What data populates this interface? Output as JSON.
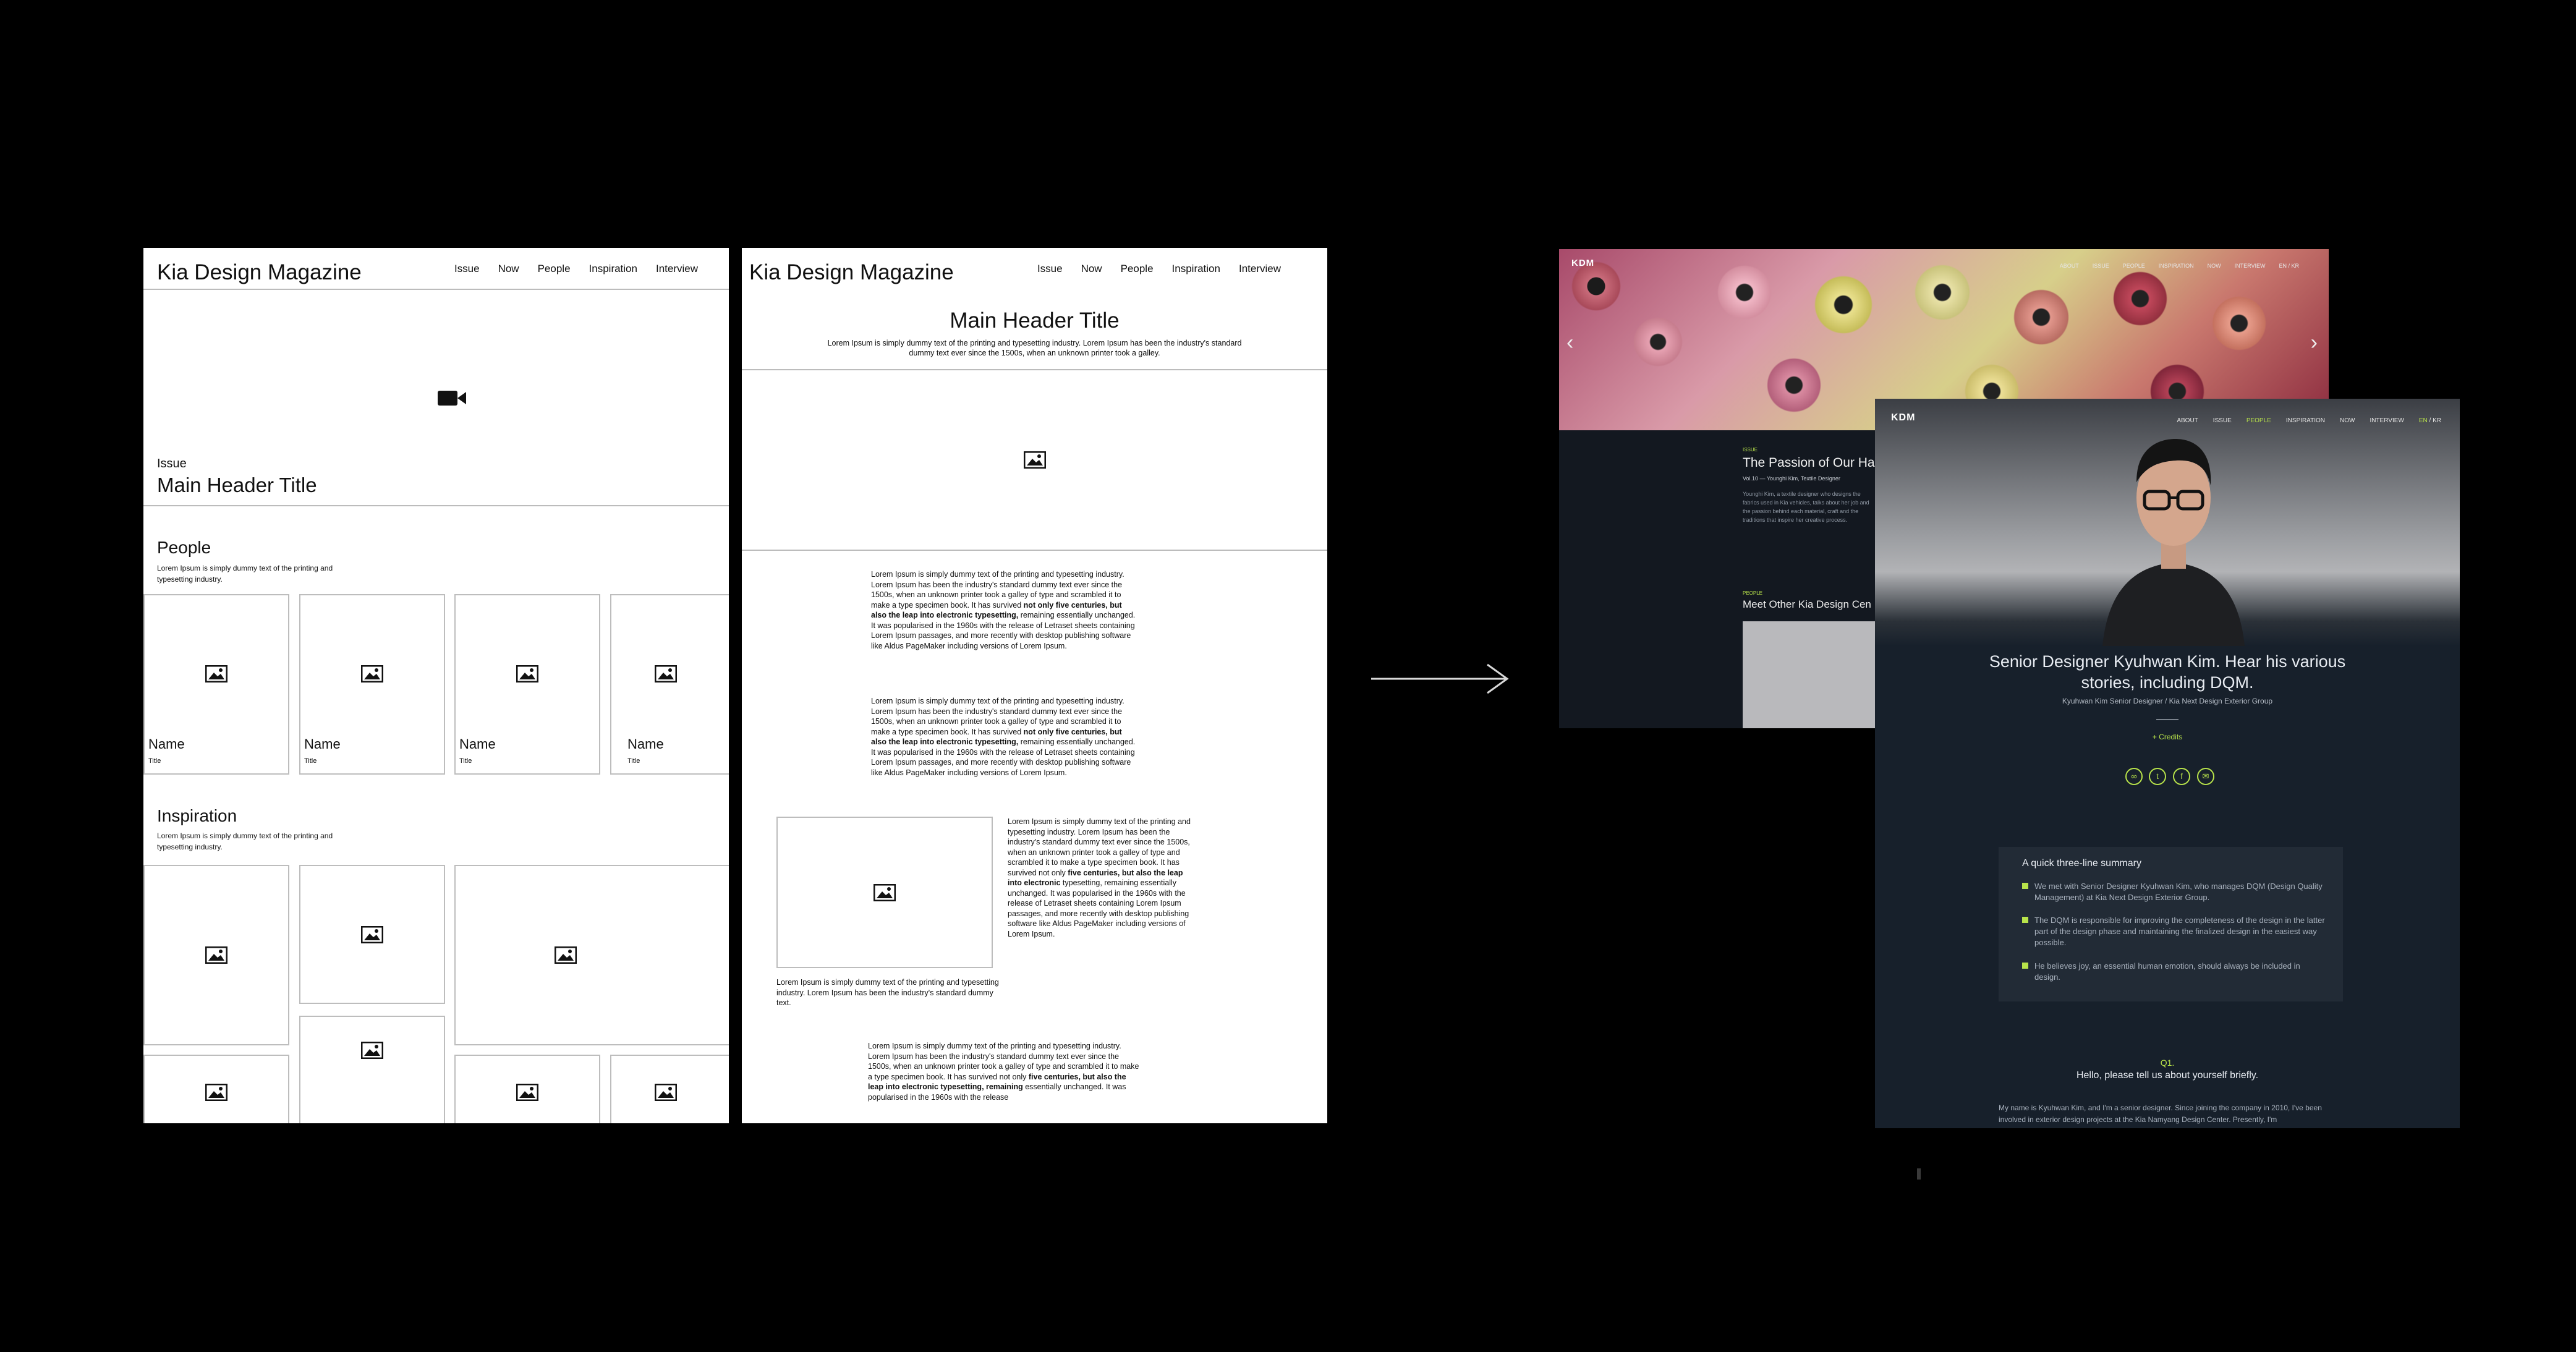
{
  "wireframe_list": {
    "brand": "Kia Design Magazine",
    "nav": [
      "Issue",
      "Now",
      "People",
      "Inspiration",
      "Interview"
    ],
    "hero_label": "Issue",
    "hero_title": "Main Header Title",
    "people_title": "People",
    "people_desc": "Lorem Ipsum is simply dummy text of the printing and typesetting industry.",
    "cards": [
      {
        "name": "Name",
        "title": "Title"
      },
      {
        "name": "Name",
        "title": "Title"
      },
      {
        "name": "Name",
        "title": "Title"
      },
      {
        "name": "Name",
        "title": "Title"
      }
    ],
    "inspiration_title": "Inspiration",
    "inspiration_desc": "Lorem Ipsum is simply dummy text of the printing and typesetting industry."
  },
  "wireframe_article": {
    "brand": "Kia Design Magazine",
    "nav": [
      "Issue",
      "Now",
      "People",
      "Inspiration",
      "Interview"
    ],
    "title": "Main Header Title",
    "subtitle": "Lorem Ipsum is simply dummy text of the printing and typesetting industry. Lorem Ipsum has been the industry's standard dummy text ever since the 1500s, when an unknown printer took a galley.",
    "para_a": "Lorem Ipsum is simply dummy text of the printing and typesetting industry. Lorem Ipsum has been the industry's standard dummy text ever since the 1500s, when an unknown printer took a galley of type and scrambled it to make a type specimen book. It has survived",
    "para_bold": "not only five centuries, but also the leap into electronic typesetting,",
    "para_b": "remaining essentially unchanged. It was popularised in the 1960s with the release of Letraset sheets containing Lorem Ipsum passages, and more recently with desktop publishing software like Aldus PageMaker including versions of Lorem Ipsum.",
    "side_a": "Lorem Ipsum is simply dummy text of the printing and typesetting industry. Lorem Ipsum has been the industry's standard dummy text ever since the 1500s, when an unknown printer took a galley of type and scrambled it to make a type specimen book. It has survived not only",
    "side_bold": "five centuries, but also the leap into electronic",
    "side_b": "typesetting, remaining essentially unchanged. It was popularised in the 1960s with the release of Letraset sheets containing Lorem Ipsum passages, and more recently with desktop publishing software like Aldus PageMaker including versions of Lorem Ipsum.",
    "caption": "Lorem Ipsum is simply dummy text of the printing and typesetting industry. Lorem Ipsum has been the industry's standard dummy text.",
    "para_c": "Lorem Ipsum is simply dummy text of the printing and typesetting industry. Lorem Ipsum has been the industry's standard dummy text ever since the 1500s, when an unknown printer took a galley of type and scrambled it to make a type specimen book. It has survived not only",
    "para_c_bold": "five centuries, but also the leap into electronic typesetting, remaining",
    "para_c_b": "essentially unchanged. It was popularised in the 1960s with the release"
  },
  "design_back": {
    "logo": "KDM",
    "nav": [
      "ABOUT",
      "ISSUE",
      "PEOPLE",
      "INSPIRATION",
      "NOW",
      "INTERVIEW"
    ],
    "lang": "EN / KR",
    "label": "ISSUE",
    "title": "The Passion of Our Ha",
    "meta": "Vol.10 — Younghi Kim, Textile Designer",
    "desc": "Younghi Kim, a textile designer who designs the fabrics used in Kia vehicles, talks about her job and the passion behind each material, craft and the traditions that inspire her creative process.",
    "people_label": "PEOPLE",
    "people_title": "Meet Other Kia Design Cen"
  },
  "design_front": {
    "logo": "KDM",
    "nav": [
      "ABOUT",
      "ISSUE",
      "PEOPLE",
      "INSPIRATION",
      "NOW",
      "INTERVIEW"
    ],
    "lang_en": "EN",
    "lang_kr": "KR",
    "headline": "Senior Designer Kyuhwan Kim. Hear his various stories, including DQM.",
    "byline": "Kyuhwan Kim Senior Designer / Kia Next Design Exterior Group",
    "credits": "+ Credits",
    "share_icons": [
      "link-icon",
      "twitter-icon",
      "facebook-icon",
      "mail-icon"
    ],
    "summary_title": "A quick three-line summary",
    "summary": [
      "We met with Senior Designer Kyuhwan Kim, who manages DQM (Design Quality Management) at Kia Next Design Exterior Group.",
      "The DQM is responsible for improving the completeness of the design in the latter part of the design phase and maintaining the finalized design in the easiest way possible.",
      "He believes joy, an essential human emotion, should always be included in design."
    ],
    "q_num": "Q1.",
    "q_text": "Hello, please tell us about yourself briefly.",
    "answer": "My name is Kyuhwan Kim, and I'm a senior designer. Since joining the company in 2010, I've been involved in exterior design projects at the Kia Namyang Design Center. Presently, I'm",
    "accent": "#b8e34a"
  }
}
